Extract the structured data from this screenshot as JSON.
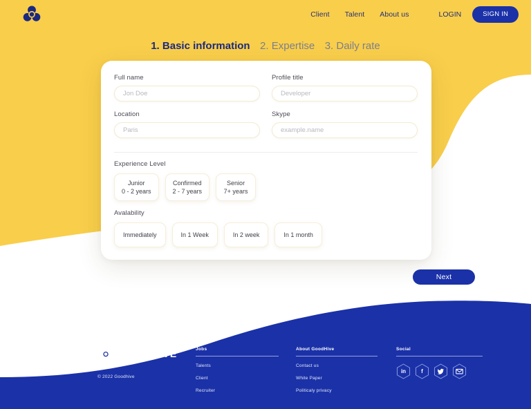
{
  "colors": {
    "yellow": "#F9CE4B",
    "blue": "#1B31A8",
    "white": "#FFFFFF",
    "step_active": "#1B2A80",
    "step_inactive": "#7B7F8E",
    "input_border": "#F3EAD2"
  },
  "header": {
    "logo_alt": "GoodHive logo",
    "nav": [
      {
        "label": "Client"
      },
      {
        "label": "Talent"
      },
      {
        "label": "About us"
      }
    ],
    "login_label": "LOGIN",
    "signin_label": "SIGN IN"
  },
  "steps": [
    {
      "label": "1. Basic information",
      "active": true
    },
    {
      "label": "2. Expertise",
      "active": false
    },
    {
      "label": "3. Daily rate",
      "active": false
    }
  ],
  "form": {
    "fields": [
      {
        "label": "Full name",
        "value": "",
        "placeholder": "Jon Doe"
      },
      {
        "label": "Profile title",
        "value": "",
        "placeholder": "Developer"
      },
      {
        "label": "Location",
        "value": "",
        "placeholder": "Paris"
      },
      {
        "label": "Skype",
        "value": "",
        "placeholder": "example.name"
      }
    ],
    "experience": {
      "label": "Experience Level",
      "options": [
        {
          "title": "Junior",
          "sub": "0 - 2 years"
        },
        {
          "title": "Confirmed",
          "sub": "2 - 7 years"
        },
        {
          "title": "Senior",
          "sub": "7+ years"
        }
      ]
    },
    "availability": {
      "label": "Avalability",
      "options": [
        {
          "label": "Immediately"
        },
        {
          "label": "In 1 Week"
        },
        {
          "label": "In 2 week"
        },
        {
          "label": "In 1 month"
        }
      ]
    }
  },
  "next_button": {
    "label": "Next"
  },
  "footer": {
    "wordmark": "GOODHIVE",
    "copyright": "© 2022 Goodhive",
    "columns": [
      {
        "heading": "Jobs",
        "links": [
          {
            "label": "Talents"
          },
          {
            "label": "Client"
          },
          {
            "label": "Recruiter"
          }
        ]
      },
      {
        "heading": "About GoodHive",
        "links": [
          {
            "label": "Contact us"
          },
          {
            "label": "White Paper"
          },
          {
            "label": "Politicaly privacy"
          }
        ]
      }
    ],
    "social": {
      "heading": "Social",
      "items": [
        {
          "name": "linkedin",
          "glyph": "in"
        },
        {
          "name": "facebook",
          "glyph": "f"
        },
        {
          "name": "twitter",
          "glyph": ""
        },
        {
          "name": "email",
          "glyph": ""
        }
      ]
    }
  }
}
